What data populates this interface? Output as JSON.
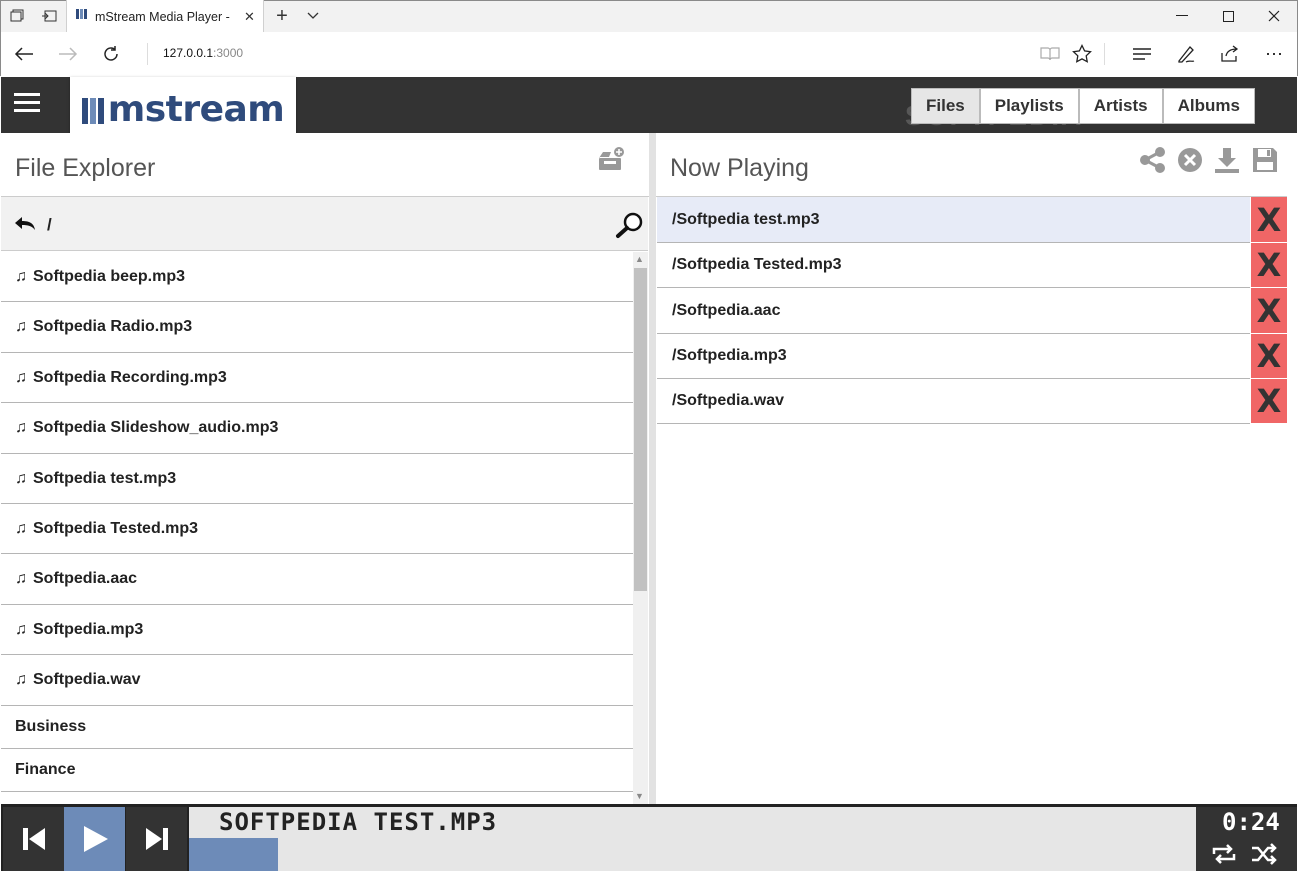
{
  "browser": {
    "tab_title": "mStream Media Player -",
    "url_host": "127.0.0.1",
    "url_port": ":3000"
  },
  "app": {
    "logo_text": "mstream",
    "nav_tabs": [
      {
        "label": "Files",
        "active": true
      },
      {
        "label": "Playlists",
        "active": false
      },
      {
        "label": "Artists",
        "active": false
      },
      {
        "label": "Albums",
        "active": false
      }
    ],
    "watermark": "SOFTPEDIA"
  },
  "file_explorer": {
    "title": "File Explorer",
    "path": "/",
    "files": [
      "Softpedia beep.mp3",
      "Softpedia Radio.mp3",
      "Softpedia Recording.mp3",
      "Softpedia Slideshow_audio.mp3",
      "Softpedia test.mp3",
      "Softpedia Tested.mp3",
      "Softpedia.aac",
      "Softpedia.mp3",
      "Softpedia.wav"
    ],
    "folders": [
      "Business",
      "Finance"
    ]
  },
  "now_playing": {
    "title": "Now Playing",
    "remove_label": "X",
    "items": [
      {
        "label": "/Softpedia test.mp3",
        "selected": true
      },
      {
        "label": "/Softpedia Tested.mp3",
        "selected": false
      },
      {
        "label": "/Softpedia.aac",
        "selected": false
      },
      {
        "label": "/Softpedia.mp3",
        "selected": false
      },
      {
        "label": "/Softpedia.wav",
        "selected": false
      }
    ]
  },
  "player": {
    "song_title": "SOFTPEDIA TEST.MP3",
    "time": "0:24",
    "progress_fraction": 0.09
  },
  "colors": {
    "header_bg": "#333333",
    "accent": "#6d8bb8",
    "remove_red": "#f06666",
    "selected_row": "#e7ebf7"
  }
}
